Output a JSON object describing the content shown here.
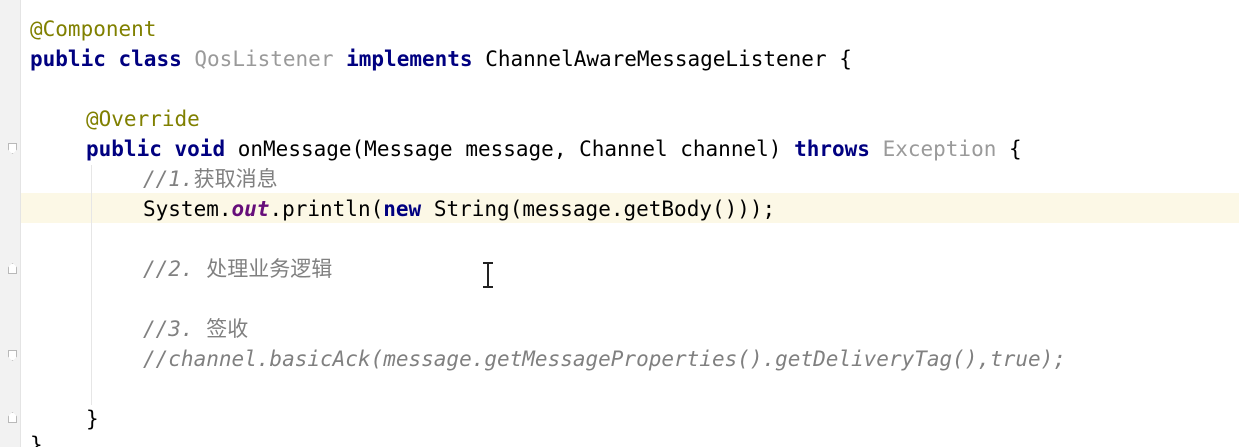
{
  "editor": {
    "lines": {
      "l1": {
        "annotation": "@Component"
      },
      "l2": {
        "kw_public": "public",
        "kw_class": "class",
        "class_name": "QosListener",
        "kw_implements": "implements",
        "interface": "ChannelAwareMessageListener",
        "brace": " {"
      },
      "l4": {
        "annotation": "@Override"
      },
      "l5": {
        "kw_public": "public",
        "kw_void": "void",
        "signature": "onMessage(Message message, Channel channel)",
        "kw_throws": "throws",
        "exception": "Exception",
        "brace": " {"
      },
      "l6": {
        "comment_prefix": "//1.",
        "comment_text": "获取消息"
      },
      "l7": {
        "receiver": "System.",
        "field": "out",
        "call": ".println(",
        "kw_new": "new",
        "rest": " String(message.getBody()));"
      },
      "l9": {
        "comment_prefix": "//2. ",
        "comment_text": "处理业务逻辑"
      },
      "l11": {
        "comment_prefix": "//3. ",
        "comment_text": "签收"
      },
      "l12": {
        "comment": "//channel.basicAck(message.getMessageProperties().getDeliveryTag(),true);"
      },
      "l14": {
        "brace": "}"
      },
      "l15": {
        "brace": "}"
      }
    }
  },
  "cursor": {
    "icon": "text-ibeam-cursor-icon"
  },
  "colors": {
    "annotation": "#808000",
    "keyword": "#000080",
    "comment": "#808080",
    "unused_symbol": "#9a9a9a",
    "static_field": "#660e7a",
    "caret_row_highlight": "#fcf8e6",
    "gutter": "#f2f2f2"
  }
}
